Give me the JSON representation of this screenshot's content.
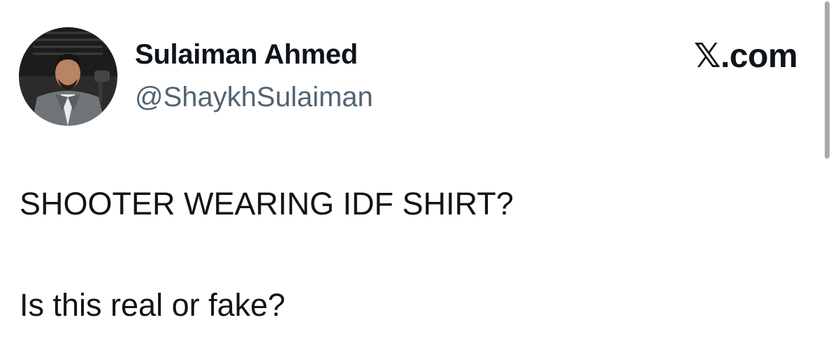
{
  "tweet": {
    "author": {
      "display_name": "Sulaiman Ahmed",
      "handle": "@ShaykhSulaiman"
    },
    "brand": "𝕏.com",
    "text_lines": [
      "SHOOTER WEARING IDF SHIRT?",
      "Is this real or fake?"
    ]
  },
  "colors": {
    "text_primary": "#0f1419",
    "text_secondary": "#536471",
    "background": "#ffffff"
  }
}
